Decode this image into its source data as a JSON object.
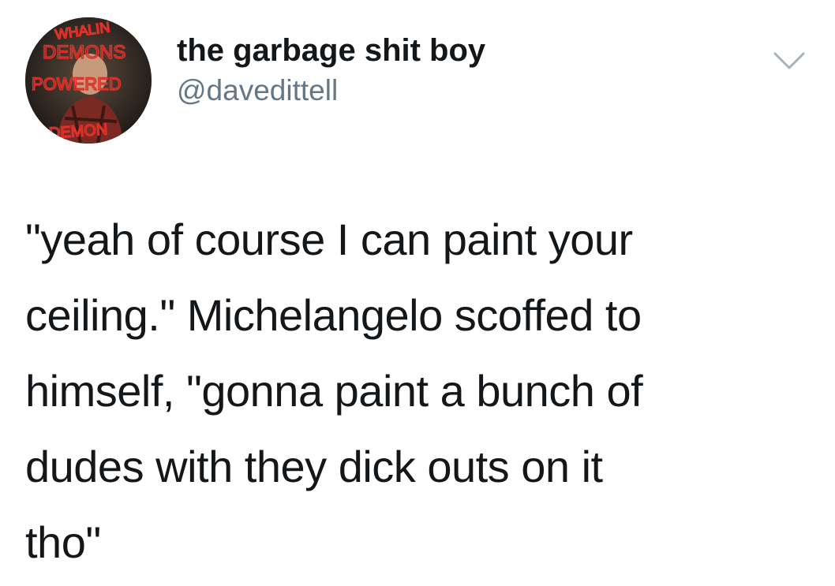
{
  "tweet": {
    "author": {
      "display_name": "the garbage shit boy",
      "handle": "@davedittell",
      "avatar_text": [
        "WHALIN",
        "DEMONS",
        "POWERED",
        "DEMON"
      ]
    },
    "text": "\"yeah of course I can paint your\nceiling.\" Michelangelo scoffed to\nhimself, \"gonna paint a bunch of\ndudes with they dick outs on it\ntho\"",
    "menu_icon": "chevron-down-icon"
  },
  "colors": {
    "text": "#14171a",
    "secondary": "#657786",
    "avatar_scrawl": "#e0302a"
  }
}
